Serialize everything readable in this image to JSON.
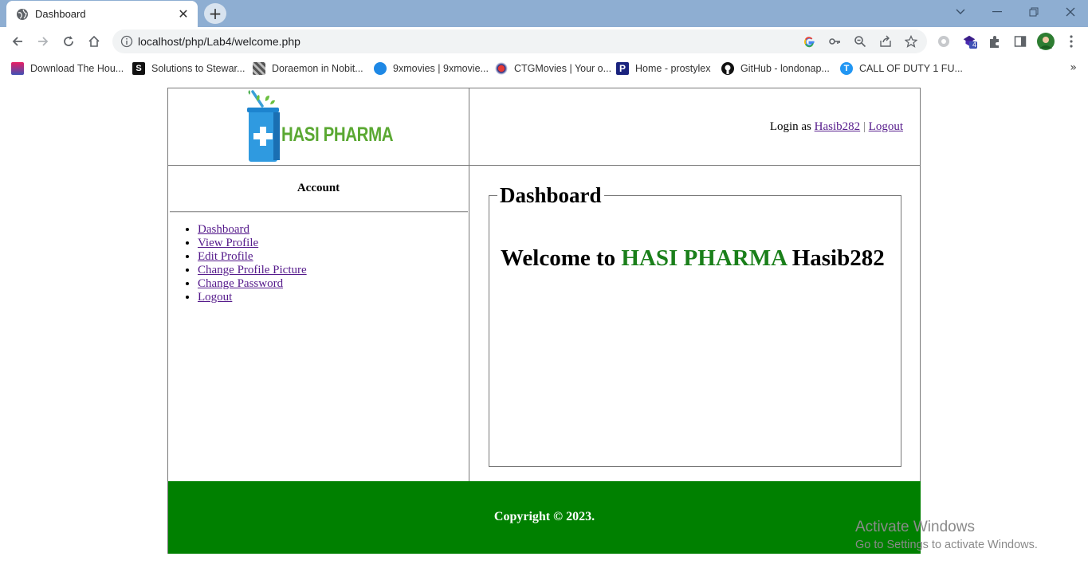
{
  "browser": {
    "tab_title": "Dashboard",
    "url": "localhost/php/Lab4/welcome.php",
    "bookmarks": [
      {
        "label": "Download The Hou...",
        "color": "#c2185b"
      },
      {
        "label": "Solutions to Stewar...",
        "color": "#111111"
      },
      {
        "label": "Doraemon in Nobit...",
        "color": "#555555"
      },
      {
        "label": "9xmovies | 9xmovie...",
        "color": "#1e88e5"
      },
      {
        "label": "CTGMovies | Your o...",
        "color": "#8e1b3a"
      },
      {
        "label": "Home - prostylex",
        "color": "#1a237e"
      },
      {
        "label": "GitHub - londonap...",
        "color": "#111111"
      },
      {
        "label": "CALL OF DUTY 1 FU...",
        "color": "#2196f3"
      }
    ],
    "extension_badge": "4"
  },
  "header": {
    "logo_text": "HASI PHARMA",
    "login_prefix": "Login as",
    "username": "Hasib282",
    "separator": "|",
    "logout_label": "Logout"
  },
  "sidebar": {
    "title": "Account",
    "items": [
      "Dashboard",
      "View Profile",
      "Edit Profile",
      "Change Profile Picture",
      "Change Password",
      "Logout"
    ]
  },
  "main": {
    "legend": "Dashboard",
    "welcome_prefix": "Welcome to",
    "welcome_brand": "HASI PHARMA",
    "welcome_user": "Hasib282"
  },
  "footer": {
    "copyright": "Copyright © 2023."
  },
  "watermark": {
    "line1": "Activate Windows",
    "line2": "Go to Settings to activate Windows."
  }
}
